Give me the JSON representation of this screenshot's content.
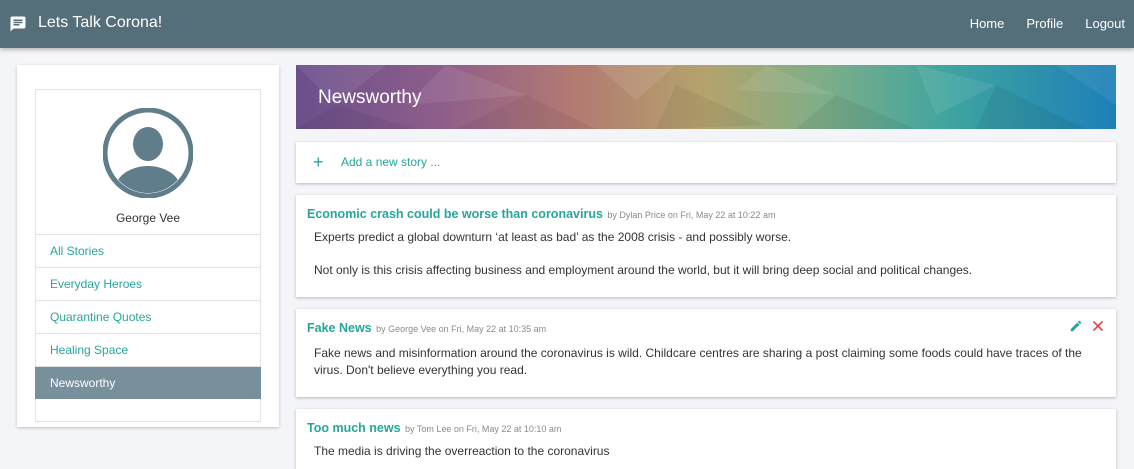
{
  "app": {
    "title": "Lets Talk Corona!",
    "icon": "chat-icon"
  },
  "nav": {
    "home": "Home",
    "profile": "Profile",
    "logout": "Logout"
  },
  "sidebar": {
    "username": "George Vee",
    "avatar_icon": "account-circle-icon",
    "items": [
      {
        "label": "All Stories"
      },
      {
        "label": "Everyday Heroes"
      },
      {
        "label": "Quarantine Quotes"
      },
      {
        "label": "Healing Space"
      },
      {
        "label": "Newsworthy",
        "active": true
      }
    ]
  },
  "banner": {
    "title": "Newsworthy"
  },
  "add_story": {
    "label": "Add a new story ..."
  },
  "stories": [
    {
      "title": "Economic crash could be worse than coronavirus",
      "meta": "by Dylan Price on Fri, May 22 at 10:22 am",
      "paragraphs": [
        "Experts predict a global downturn ‘at least as bad’ as the 2008 crisis - and possibly worse.",
        "Not only is this crisis affecting business and employment around the world, but it will bring deep social and political changes."
      ]
    },
    {
      "title": "Fake News",
      "meta": "by George Vee on Fri, May 22 at 10:35 am",
      "paragraphs": [
        "Fake news and misinformation around the coronavirus is wild. Childcare centres are sharing a post claiming some foods could have traces of the virus. Don't believe everything you read."
      ],
      "editable": true
    },
    {
      "title": "Too much news",
      "meta": "by Tom Lee on Fri, May 22 at 10:10 am",
      "paragraphs": [
        "The media is driving the overreaction to the coronavirus"
      ]
    }
  ],
  "colors": {
    "topbar": "#546e7a",
    "accent": "#26a69a",
    "active_item": "#78909c",
    "delete": "#e53935"
  }
}
